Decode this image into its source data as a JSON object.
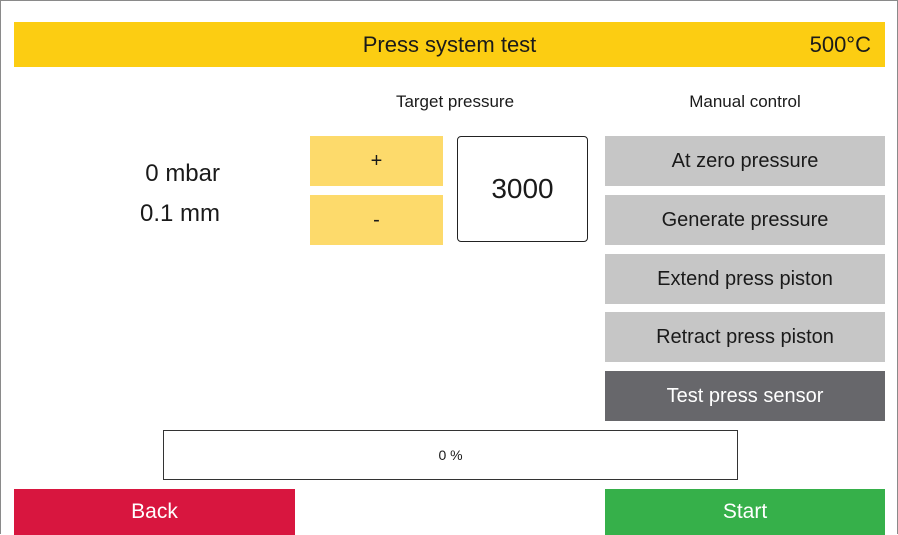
{
  "header": {
    "title": "Press system test",
    "temperature": "500°C"
  },
  "readouts": {
    "pressure": "0 mbar",
    "distance": "0.1 mm"
  },
  "target": {
    "label": "Target pressure",
    "increase_label": "+",
    "decrease_label": "-",
    "value": "3000"
  },
  "manual": {
    "label": "Manual control",
    "buttons": [
      {
        "label": "At zero pressure"
      },
      {
        "label": "Generate pressure"
      },
      {
        "label": "Extend press piston"
      },
      {
        "label": "Retract press piston"
      },
      {
        "label": "Test press sensor"
      }
    ]
  },
  "progress": {
    "value": 0,
    "text": "0 %"
  },
  "footer": {
    "back_label": "Back",
    "start_label": "Start"
  },
  "colors": {
    "header": "#fccd12",
    "adjust_button": "#fdda6b",
    "manual_button": "#c6c6c6",
    "manual_button_active": "#67676b",
    "back": "#d8163f",
    "start": "#36b04a"
  }
}
